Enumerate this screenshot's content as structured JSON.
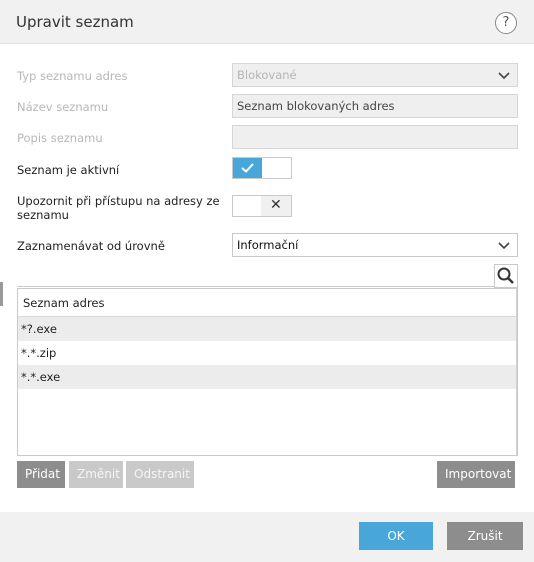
{
  "dialog": {
    "title": "Upravit seznam",
    "help_icon": "question-mark-icon"
  },
  "form": {
    "list_type": {
      "label": "Typ seznamu adres",
      "value": "Blokované"
    },
    "list_name": {
      "label": "Název seznamu",
      "value": "Seznam blokovaných adres"
    },
    "list_description": {
      "label": "Popis seznamu",
      "value": ""
    },
    "list_active": {
      "label": "Seznam je aktivní",
      "state": "on"
    },
    "notify_access": {
      "label_line1": "Upozornit při přístupu na adresy ze",
      "label_line2": "seznamu",
      "state": "off"
    },
    "log_level": {
      "label": "Zaznamenávat od úrovně",
      "value": "Informační"
    }
  },
  "address_table": {
    "header": "Seznam adres",
    "rows": [
      "*?.exe",
      "*.*.zip",
      "*.*.exe"
    ]
  },
  "actions": {
    "add": "Přidat",
    "edit": "Změnit",
    "remove": "Odstranit",
    "import": "Importovat"
  },
  "footer": {
    "ok": "OK",
    "cancel": "Zrušit"
  },
  "colors": {
    "accent": "#48a7d8",
    "button_dark": "#8d8d8d",
    "button_disabled": "#c9c9c9"
  }
}
